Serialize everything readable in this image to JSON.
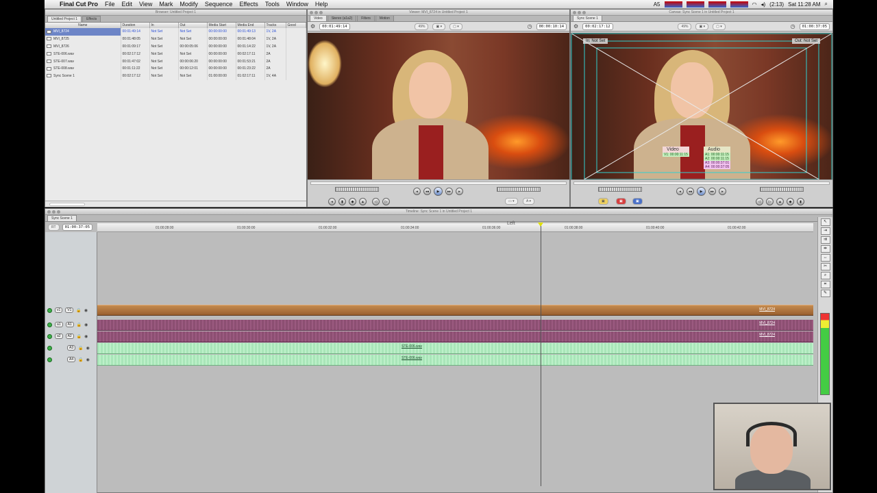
{
  "menubar": {
    "app": "Final Cut Pro",
    "items": [
      "File",
      "Edit",
      "View",
      "Mark",
      "Modify",
      "Sequence",
      "Effects",
      "Tools",
      "Window",
      "Help"
    ],
    "clock": "Sat 11:28 AM",
    "battery": "(2:13)",
    "ai_badge": "A5"
  },
  "browser": {
    "title": "Browser: Untitled Project 1",
    "tabs": [
      "Untitled Project 1",
      "Effects"
    ],
    "columns": [
      "Name",
      "Duration",
      "In",
      "Out",
      "Media Start",
      "Media End",
      "Tracks",
      "Good"
    ],
    "rows": [
      {
        "name": "MVI_8724",
        "duration": "00:01:49:14",
        "in": "Not Set",
        "out": "Not Set",
        "media_start": "00:00:00:00",
        "media_end": "00:01:49:13",
        "tracks": "1V, 2A",
        "selected": true
      },
      {
        "name": "MVI_8725",
        "duration": "00:01:48:05",
        "in": "Not Set",
        "out": "Not Set",
        "media_start": "00:00:00:00",
        "media_end": "00:01:48:04",
        "tracks": "1V, 2A"
      },
      {
        "name": "MVI_8726",
        "duration": "00:01:09:17",
        "in": "Not Set",
        "out": "00:00:05:06",
        "media_start": "00:00:00:00",
        "media_end": "00:01:14:22",
        "tracks": "1V, 2A"
      },
      {
        "name": "STE-006.wav",
        "duration": "00:02:17:12",
        "in": "Not Set",
        "out": "Not Set",
        "media_start": "00:00:00:00",
        "media_end": "00:02:17:11",
        "tracks": "2A"
      },
      {
        "name": "STE-007.wav",
        "duration": "00:01:47:02",
        "in": "Not Set",
        "out": "00:00:06:20",
        "media_start": "00:00:00:00",
        "media_end": "00:01:53:21",
        "tracks": "2A"
      },
      {
        "name": "STE-008.wav",
        "duration": "00:01:11:22",
        "in": "Not Set",
        "out": "00:00:12:01",
        "media_start": "00:00:00:00",
        "media_end": "00:01:23:22",
        "tracks": "2A"
      },
      {
        "name": "Sync Scene 1",
        "duration": "00:02:17:12",
        "in": "Not Set",
        "out": "Not Set",
        "media_start": "01:00:00:00",
        "media_end": "01:02:17:11",
        "tracks": "1V, 4A"
      }
    ]
  },
  "viewer": {
    "title": "Viewer: MVI_8724 in Untitled Project 1",
    "tabs": [
      "Video",
      "Stereo (a1a2)",
      "Filters",
      "Motion"
    ],
    "duration_tc": "00:01:49:14",
    "zoom": "49%",
    "current_tc": "00:00:10:14"
  },
  "canvas": {
    "title": "Canvas: Sync Scene 1 in Untitled Project 1",
    "tab": "Sync Scene 1",
    "duration_tc": "00:02:17:12",
    "zoom": "49%",
    "current_tc": "01:00:37:05",
    "in_label": "In: Not Set",
    "out_label": "Out: Not Set",
    "overlay": {
      "video_header": "Video",
      "audio_header": "Audio",
      "v1": "V1: 00:00:11:15",
      "a1": "A1: 00:00:11:15",
      "a2": "A2: 00:00:11:15",
      "a3": "A3: 00:00:37:01",
      "a4": "A4: 00:00:37:05"
    }
  },
  "timeline": {
    "title": "Timeline: Sync Scene 1 in Untitled Project 1",
    "tab": "Sync Scene 1",
    "rt": "RT",
    "current_tc": "01:00:37:05",
    "ruler": [
      "01:00:28:00",
      "01:00:30:00",
      "01:00:32:00",
      "01:00:34:00",
      "01:00:36:00",
      "01:00:38:00",
      "01:00:40:00",
      "01:00:42:00"
    ],
    "hover_label": "Left",
    "tracks": {
      "v1": {
        "src": "v1",
        "dst": "V1"
      },
      "a1": {
        "src": "a1",
        "dst": "A1"
      },
      "a2": {
        "src": "a2",
        "dst": "A2"
      },
      "a3": {
        "dst": "A3"
      },
      "a4": {
        "dst": "A4"
      }
    },
    "clips": {
      "video": "MVI_8724",
      "audio1": "MVI_8724",
      "audio2": "MVI_8724",
      "audio3": "STE-006.wav",
      "audio4": "STE-006.wav"
    }
  },
  "colors": {
    "video_clip": "#b07840",
    "audio_clip_camera": "#8c4f72",
    "audio_clip_external": "#a9e6b9",
    "safe_guides": "#30d0d0"
  }
}
